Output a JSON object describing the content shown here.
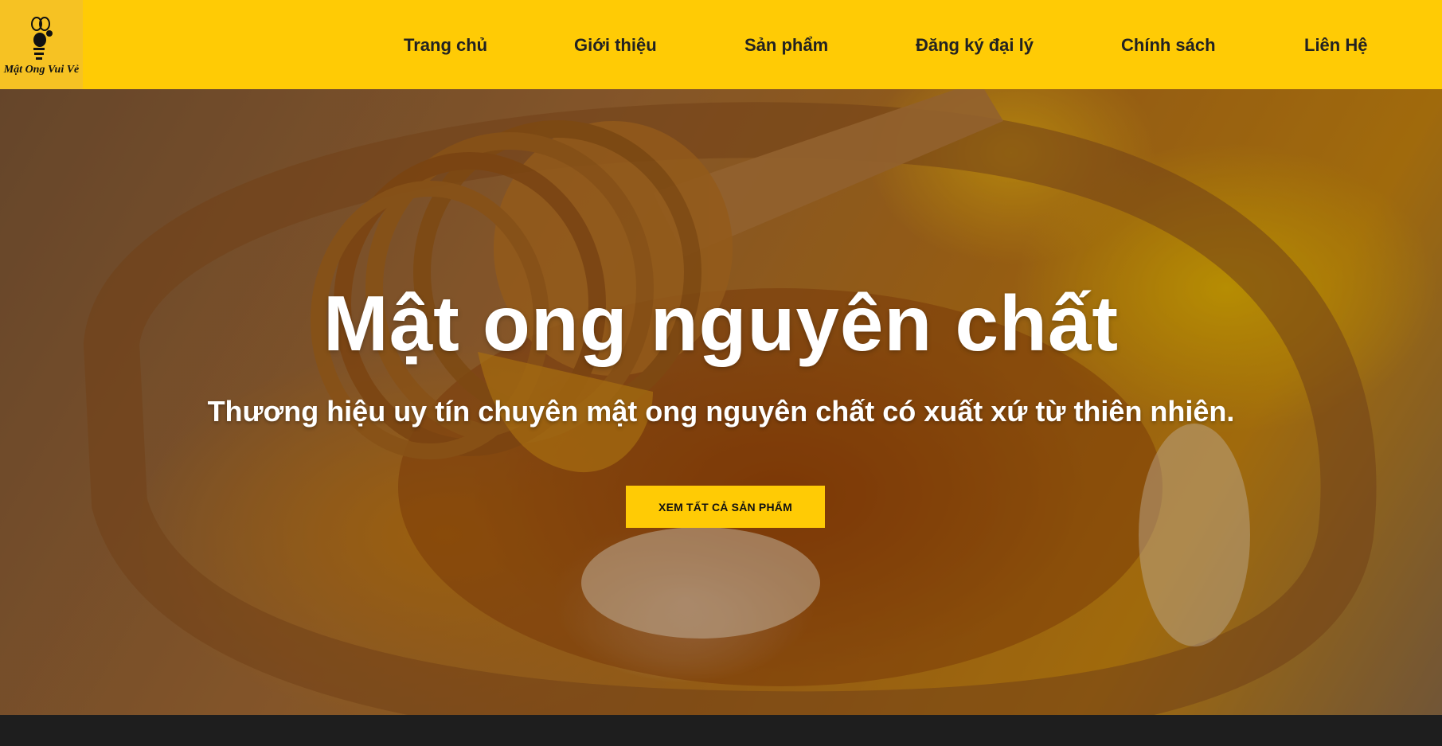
{
  "logo": {
    "text": "Mật Ong Vui Vẻ",
    "icon": "bee-icon"
  },
  "nav": {
    "items": [
      {
        "label": "Trang chủ"
      },
      {
        "label": "Giới thiệu"
      },
      {
        "label": "Sản phẩm"
      },
      {
        "label": "Đăng ký đại lý"
      },
      {
        "label": "Chính sách"
      },
      {
        "label": "Liên Hệ"
      }
    ]
  },
  "hero": {
    "title": "Mật ong nguyên chất",
    "subtitle": "Thương hiệu uy tín chuyên mật ong nguyên chất có xuất xứ từ thiên nhiên.",
    "button_label": "XEM TẤT CẢ SẢN PHẨM"
  },
  "colors": {
    "accent": "#ffcb05",
    "footer": "#1e1e1e",
    "text_dark": "#222222",
    "text_light": "#ffffff"
  }
}
